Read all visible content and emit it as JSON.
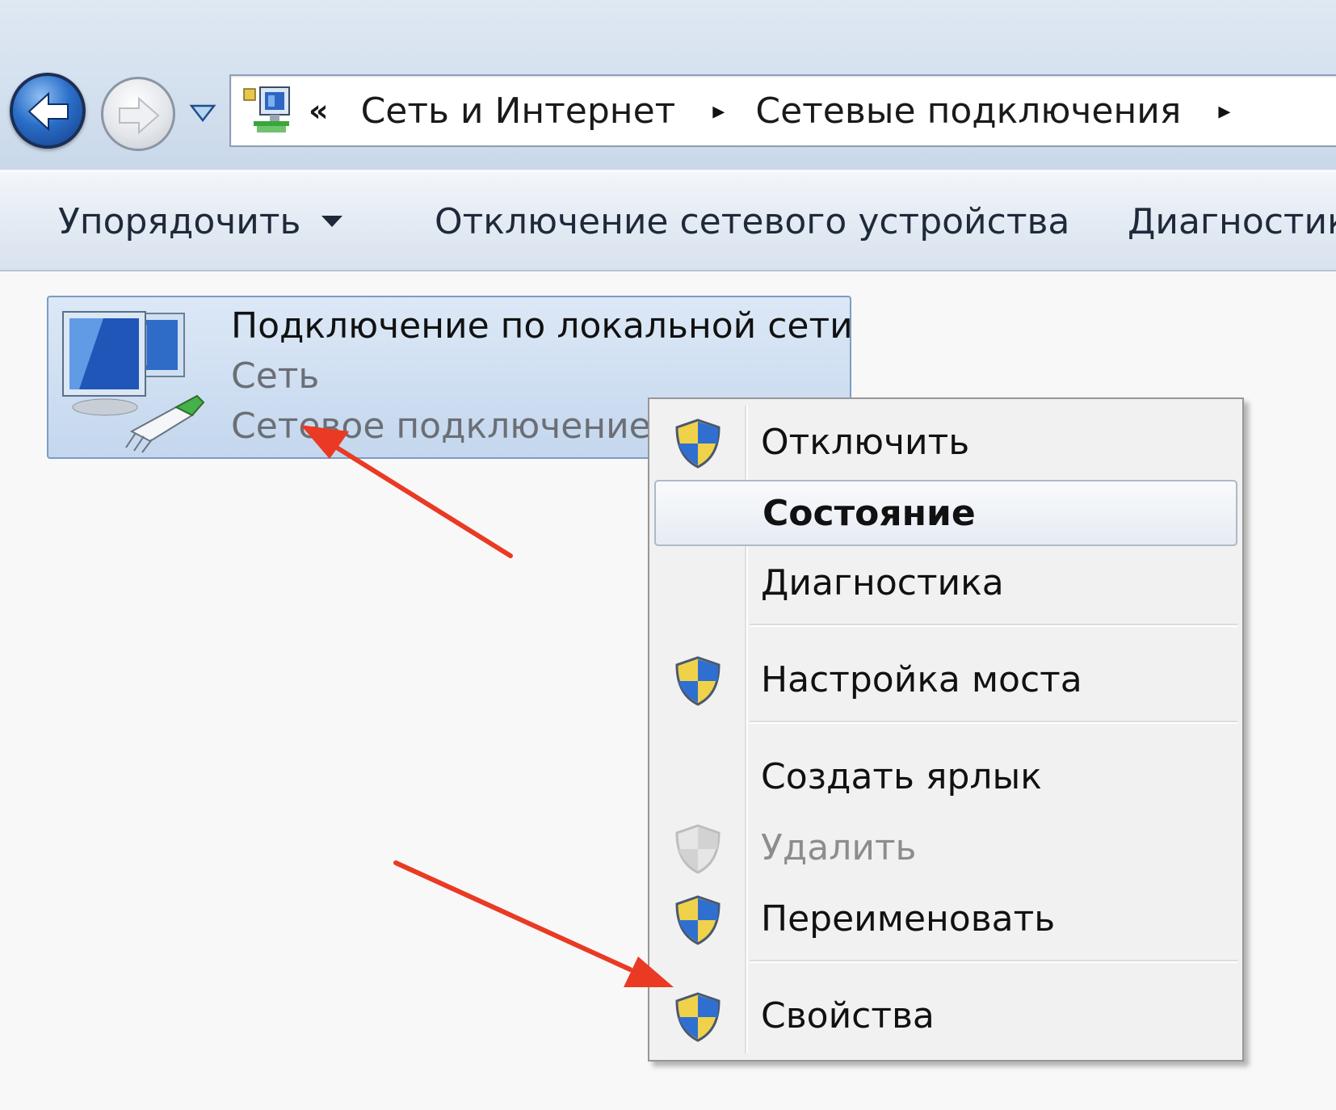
{
  "address_bar": {
    "overflow_glyph": "«",
    "breadcrumbs": [
      "Сеть и Интернет",
      "Сетевые подключения"
    ],
    "separator_glyph": "▸"
  },
  "toolbar": {
    "organize_label": "Упорядочить",
    "disable_device_label": "Отключение сетевого устройства",
    "diagnose_label": "Диагностик"
  },
  "connection": {
    "name": "Подключение по локальной сети",
    "network": "Сеть",
    "device": "Сетевое подключение I"
  },
  "context_menu": {
    "items": [
      {
        "label": "Отключить",
        "icon": "uac-shield-icon"
      },
      {
        "label": "Состояние",
        "icon": "",
        "state": "highlighted"
      },
      {
        "label": "Диагностика",
        "icon": ""
      },
      {
        "label": "Настройка моста",
        "icon": "uac-shield-icon"
      },
      {
        "label": "Создать ярлык",
        "icon": ""
      },
      {
        "label": "Удалить",
        "icon": "uac-shield-icon",
        "state": "disabled"
      },
      {
        "label": "Переименовать",
        "icon": "uac-shield-icon"
      },
      {
        "label": "Свойства",
        "icon": "uac-shield-icon"
      }
    ]
  },
  "annotations": {
    "arrow_color": "#ea3a24"
  }
}
